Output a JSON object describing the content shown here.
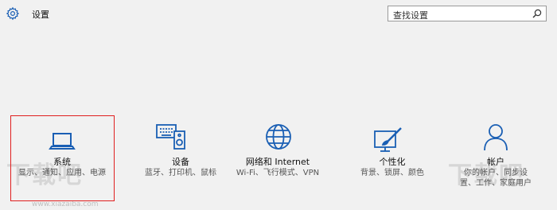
{
  "header": {
    "title": "设置",
    "gear_icon": "gear-icon",
    "search": {
      "placeholder": "查找设置",
      "icon": "search-icon"
    }
  },
  "tiles": [
    {
      "name": "系统",
      "desc": "显示、通知、应用、电源",
      "icon": "laptop-icon",
      "selected": true
    },
    {
      "name": "设备",
      "desc": "蓝牙、打印机、鼠标",
      "icon": "devices-icon"
    },
    {
      "name": "网络和 Internet",
      "desc": "Wi-Fi、飞行模式、VPN",
      "icon": "globe-icon"
    },
    {
      "name": "个性化",
      "desc": "背景、锁屏、颜色",
      "icon": "personalization-icon"
    },
    {
      "name": "帐户",
      "desc": "你的帐户、同步设置、工作、家庭用户",
      "icon": "person-icon"
    }
  ],
  "watermark": {
    "text": "下载吧",
    "url": "www.xiazaiba.com"
  },
  "colors": {
    "accent": "#1a5fb4",
    "selection": "#e01f1f",
    "background": "#f1f1f1"
  }
}
